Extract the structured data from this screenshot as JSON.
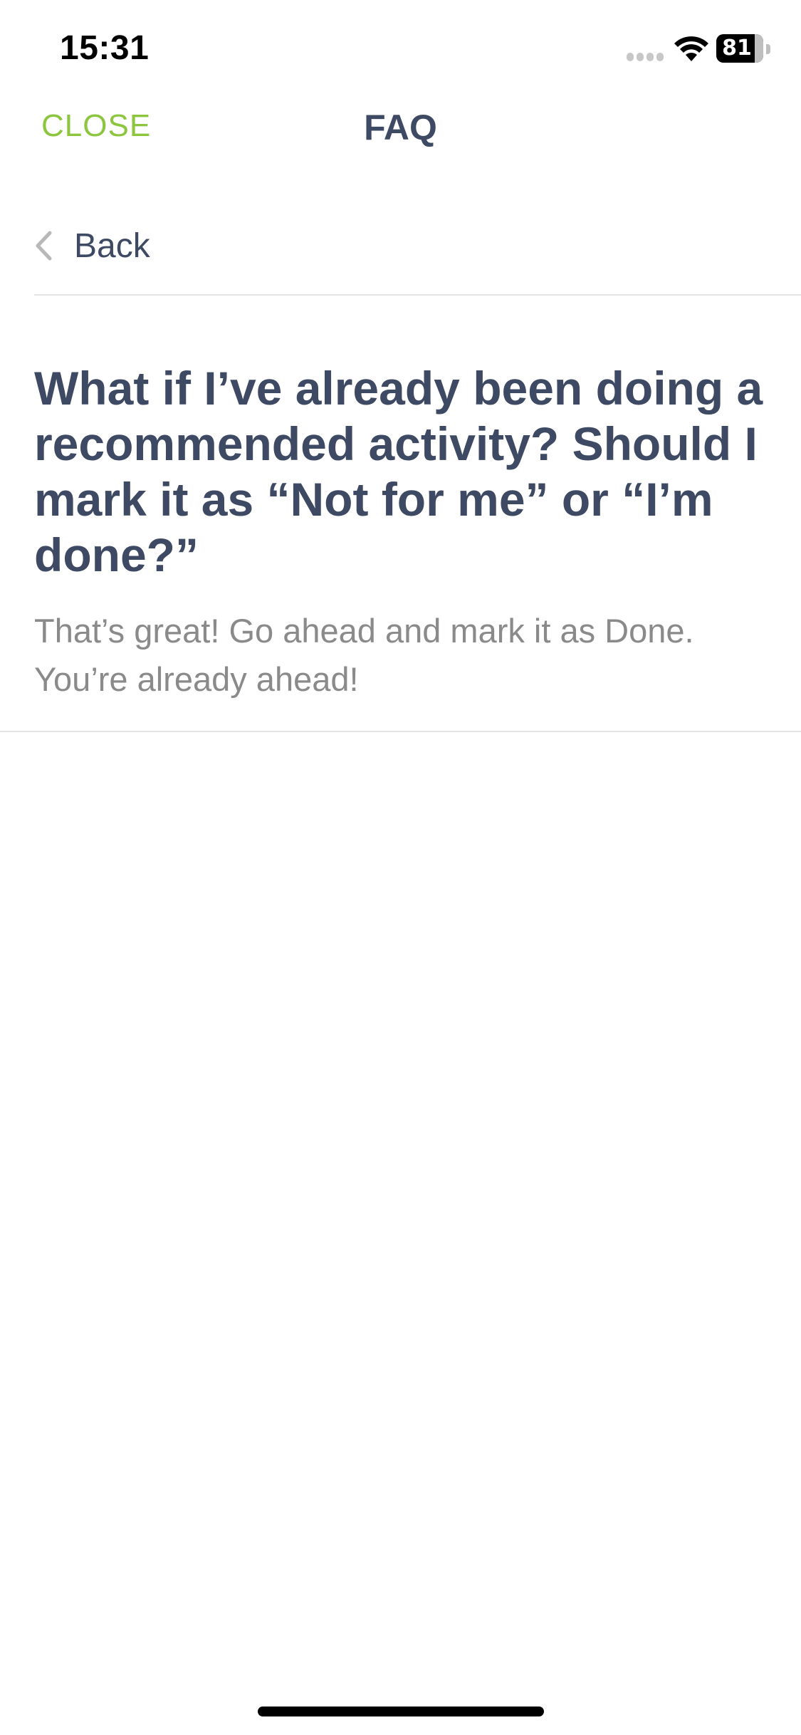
{
  "status_bar": {
    "time": "15:31",
    "battery_level": "81"
  },
  "nav": {
    "close_label": "CLOSE",
    "title": "FAQ"
  },
  "back": {
    "label": "Back"
  },
  "faq": {
    "question": "What if I’ve already been doing a recommended activity? Should I mark it as “Not for me” or “I’m done?”",
    "answer": "That’s great! Go ahead and mark it as Done. You’re already ahead!"
  },
  "colors": {
    "accent": "#8cc63f",
    "heading": "#3e4a63",
    "body_text": "#8a8a8a",
    "divider": "#e4e4e4"
  },
  "icons": {
    "back": "chevron-left-icon",
    "wifi": "wifi-icon",
    "signal": "cell-signal-icon",
    "battery": "battery-icon"
  }
}
